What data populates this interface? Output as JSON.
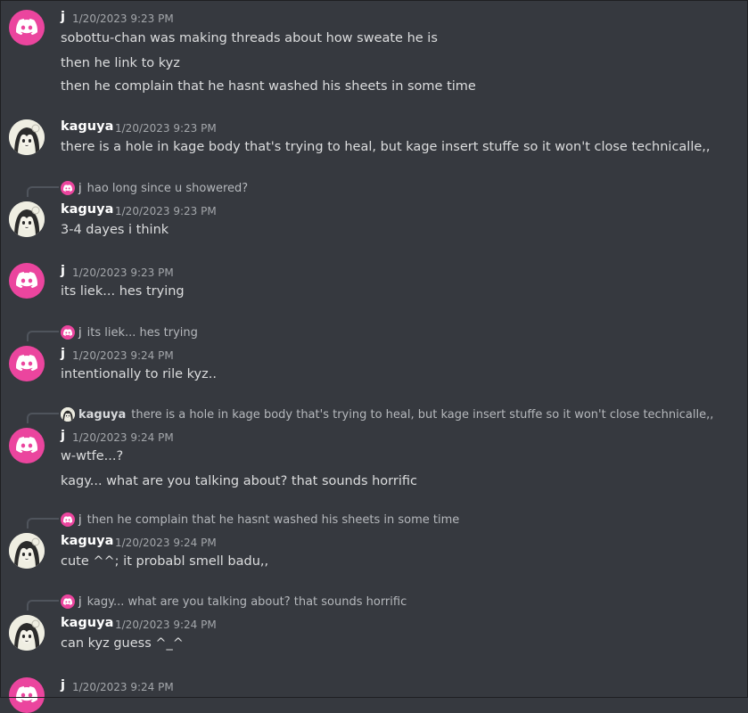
{
  "messages": [
    {
      "author": "j",
      "time": "1/20/2023 9:23 PM",
      "lines": [
        "sobottu-chan was making threads about how sweate he is",
        "then he link to kyz",
        "then he complain that he hasnt washed his sheets in some time"
      ]
    },
    {
      "author": "kaguya",
      "time": "1/20/2023 9:23 PM",
      "lines": [
        "there is a hole in kage body that's trying to heal, but kage insert stuffe so it won't close technicalle,,"
      ]
    },
    {
      "reply": {
        "author": "j",
        "text": "hao long since u showered?"
      },
      "author": "kaguya",
      "time": "1/20/2023 9:23 PM",
      "lines": [
        "3-4 dayes i think"
      ]
    },
    {
      "author": "j",
      "time": "1/20/2023 9:23 PM",
      "lines": [
        "its liek... hes trying"
      ]
    },
    {
      "reply": {
        "author": "j",
        "text": "its liek... hes trying"
      },
      "author": "j",
      "time": "1/20/2023 9:24 PM",
      "lines": [
        "intentionally to rile kyz.."
      ]
    },
    {
      "reply": {
        "author": "kaguya",
        "text": "there is a hole in kage body that's trying to heal, but kage insert stuffe so it won't close technicalle,,"
      },
      "author": "j",
      "time": "1/20/2023 9:24 PM",
      "lines": [
        "w-wtfe...?",
        "kagy... what are you talking about? that sounds horrific"
      ]
    },
    {
      "reply": {
        "author": "j",
        "text": "then he complain that he hasnt washed his sheets in some time"
      },
      "author": "kaguya",
      "time": "1/20/2023 9:24 PM",
      "lines": [
        "cute ^^; it probabl smell badu,,"
      ]
    },
    {
      "reply": {
        "author": "j",
        "text": "kagy... what are you talking about? that sounds horrific"
      },
      "author": "kaguya",
      "time": "1/20/2023 9:24 PM",
      "lines": [
        "can kyz guess ^_^"
      ]
    },
    {
      "author": "j",
      "time": "1/20/2023 9:24 PM",
      "lines": []
    }
  ],
  "colors": {
    "background": "#36393f",
    "discord_avatar": "#eb459e",
    "username": "#ffffff",
    "timestamp": "#a3a6aa",
    "text": "#dcddde"
  },
  "icons": {
    "discord_avatar": "discord-logo-icon",
    "kaguya_avatar": "anime-girl-avatar-icon"
  }
}
